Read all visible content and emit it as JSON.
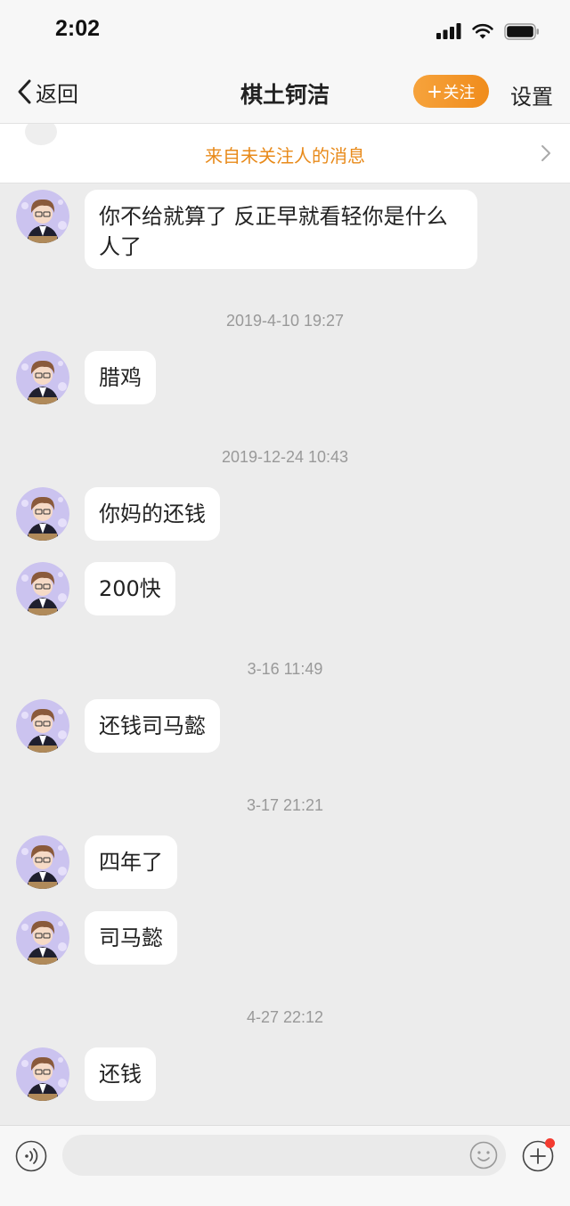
{
  "status_bar": {
    "time": "2:02"
  },
  "nav": {
    "back_label": "返回",
    "title": "棋土钶洁",
    "follow_label": "关注",
    "settings_label": "设置"
  },
  "notice": {
    "text": "来自未关注人的消息"
  },
  "messages": [
    {
      "type": "text",
      "text": "你不给就算了  反正早就看轻你是什么人了"
    },
    {
      "type": "time",
      "text": "2019-4-10 19:27"
    },
    {
      "type": "text",
      "text": "腊鸡"
    },
    {
      "type": "time",
      "text": "2019-12-24 10:43"
    },
    {
      "type": "text",
      "text": "你妈的还钱"
    },
    {
      "type": "text",
      "text": "200快"
    },
    {
      "type": "time",
      "text": "3-16 11:49"
    },
    {
      "type": "text",
      "text": "还钱司马懿"
    },
    {
      "type": "time",
      "text": "3-17 21:21"
    },
    {
      "type": "text",
      "text": "四年了"
    },
    {
      "type": "text",
      "text": "司马懿"
    },
    {
      "type": "time",
      "text": "4-27 22:12"
    },
    {
      "type": "text",
      "text": "还钱"
    }
  ],
  "input": {
    "placeholder": ""
  },
  "colors": {
    "accent": "#f08c1c",
    "notice_text": "#e88a1a",
    "chat_background": "#ececec",
    "unread_dot": "#f43b30"
  },
  "icons": [
    "back-chevron-icon",
    "signal-icon",
    "wifi-icon",
    "battery-icon",
    "voice-icon",
    "emoji-icon",
    "plus-icon",
    "chevron-right-icon"
  ]
}
